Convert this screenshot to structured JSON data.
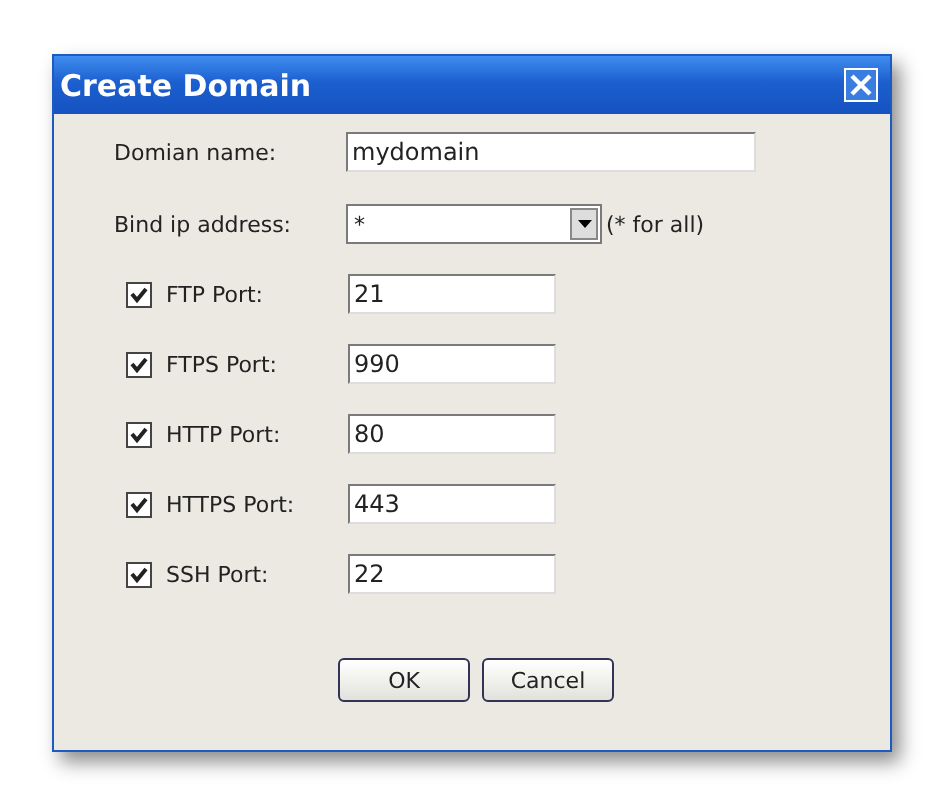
{
  "window": {
    "title": "Create Domain"
  },
  "domain_name": {
    "label": "Domian name:",
    "value": "mydomain"
  },
  "bind_ip": {
    "label": "Bind ip address:",
    "value": "*",
    "hint": "(* for all)"
  },
  "ports": [
    {
      "label": "FTP Port:",
      "checked": true,
      "value": "21"
    },
    {
      "label": "FTPS Port:",
      "checked": true,
      "value": "990"
    },
    {
      "label": "HTTP Port:",
      "checked": true,
      "value": "80"
    },
    {
      "label": "HTTPS Port:",
      "checked": true,
      "value": "443"
    },
    {
      "label": "SSH Port:",
      "checked": true,
      "value": "22"
    }
  ],
  "buttons": [
    "OK",
    "Cancel"
  ]
}
